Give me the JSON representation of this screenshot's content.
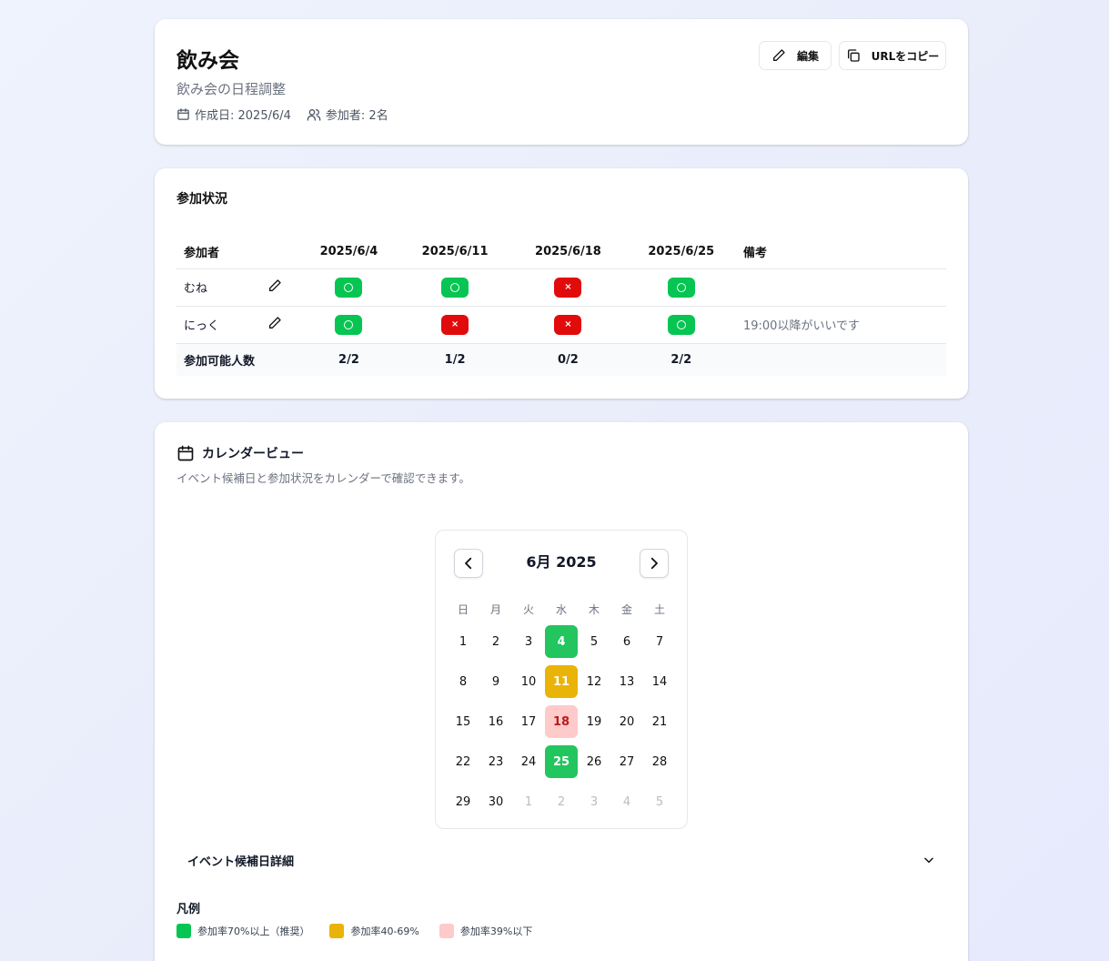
{
  "header": {
    "title": "飲み会",
    "description": "飲み会の日程調整",
    "created": "作成日: 2025/6/4",
    "participants": "参加者: 2名",
    "edit_label": "編集",
    "copy_label": "URLをコピー"
  },
  "status": {
    "title": "参加状況",
    "col_participant": "参加者",
    "dates": [
      "2025/6/4",
      "2025/6/11",
      "2025/6/18",
      "2025/6/25"
    ],
    "col_note": "備考",
    "rows": [
      {
        "name": "むね",
        "marks": [
          "○",
          "○",
          "×",
          "○"
        ],
        "note": ""
      },
      {
        "name": "にっく",
        "marks": [
          "○",
          "×",
          "×",
          "○"
        ],
        "note": "19:00以降がいいです"
      }
    ],
    "total_label": "参加可能人数",
    "totals": [
      "2/2",
      "1/2",
      "0/2",
      "2/2"
    ]
  },
  "calendar": {
    "title": "カレンダービュー",
    "subtitle": "イベント候補日と参加状況をカレンダーで確認できます。",
    "month_label": "6月 2025",
    "weekdays": [
      "日",
      "月",
      "火",
      "水",
      "木",
      "金",
      "土"
    ],
    "weeks": [
      [
        {
          "d": "1"
        },
        {
          "d": "2"
        },
        {
          "d": "3"
        },
        {
          "d": "4",
          "s": "green"
        },
        {
          "d": "5"
        },
        {
          "d": "6"
        },
        {
          "d": "7"
        }
      ],
      [
        {
          "d": "8"
        },
        {
          "d": "9"
        },
        {
          "d": "10"
        },
        {
          "d": "11",
          "s": "yellow"
        },
        {
          "d": "12"
        },
        {
          "d": "13"
        },
        {
          "d": "14"
        }
      ],
      [
        {
          "d": "15"
        },
        {
          "d": "16"
        },
        {
          "d": "17"
        },
        {
          "d": "18",
          "s": "pink"
        },
        {
          "d": "19"
        },
        {
          "d": "20"
        },
        {
          "d": "21"
        }
      ],
      [
        {
          "d": "22"
        },
        {
          "d": "23"
        },
        {
          "d": "24"
        },
        {
          "d": "25",
          "s": "green"
        },
        {
          "d": "26"
        },
        {
          "d": "27"
        },
        {
          "d": "28"
        }
      ],
      [
        {
          "d": "29"
        },
        {
          "d": "30"
        },
        {
          "d": "1",
          "s": "muted"
        },
        {
          "d": "2",
          "s": "muted"
        },
        {
          "d": "3",
          "s": "muted"
        },
        {
          "d": "4",
          "s": "muted"
        },
        {
          "d": "5",
          "s": "muted"
        }
      ]
    ],
    "details_label": "イベント候補日詳細",
    "legend_title": "凡例",
    "legend": [
      {
        "label": "参加率70%以上（推奨）",
        "color": "#07c552"
      },
      {
        "label": "参加率40-69%",
        "color": "#eab308"
      },
      {
        "label": "参加率39%以下",
        "color": "#fecaca"
      }
    ]
  },
  "colors": {
    "ok": "#07c552",
    "ng": "#e10b0b",
    "background": "#eef2fd"
  }
}
